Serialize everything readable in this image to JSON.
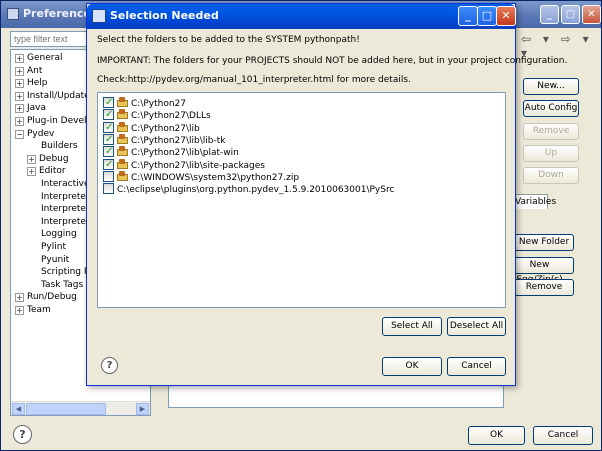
{
  "preferences": {
    "title": "Preferences",
    "filter_placeholder": "type filter text",
    "tree": [
      {
        "label": "General",
        "exp": "+",
        "indent": 0
      },
      {
        "label": "Ant",
        "exp": "+",
        "indent": 0
      },
      {
        "label": "Help",
        "exp": "+",
        "indent": 0
      },
      {
        "label": "Install/Update",
        "exp": "+",
        "indent": 0
      },
      {
        "label": "Java",
        "exp": "+",
        "indent": 0
      },
      {
        "label": "Plug-in Develop",
        "exp": "+",
        "indent": 0
      },
      {
        "label": "Pydev",
        "exp": "−",
        "indent": 0
      },
      {
        "label": "Builders",
        "exp": "",
        "indent": 1
      },
      {
        "label": "Debug",
        "exp": "+",
        "indent": 1
      },
      {
        "label": "Editor",
        "exp": "+",
        "indent": 1
      },
      {
        "label": "Interactive",
        "exp": "",
        "indent": 1
      },
      {
        "label": "Interprete",
        "exp": "",
        "indent": 1
      },
      {
        "label": "Interprete",
        "exp": "",
        "indent": 1
      },
      {
        "label": "Interprete",
        "exp": "",
        "indent": 1
      },
      {
        "label": "Logging",
        "exp": "",
        "indent": 1
      },
      {
        "label": "Pylint",
        "exp": "",
        "indent": 1
      },
      {
        "label": "Pyunit",
        "exp": "",
        "indent": 1
      },
      {
        "label": "Scripting Py",
        "exp": "",
        "indent": 1
      },
      {
        "label": "Task Tags",
        "exp": "",
        "indent": 1
      },
      {
        "label": "Run/Debug",
        "exp": "+",
        "indent": 0
      },
      {
        "label": "Team",
        "exp": "+",
        "indent": 0
      }
    ],
    "nav": {
      "back": "⇦",
      "back_menu": "▾",
      "forward": "⇨",
      "forward_menu": "▾",
      "view_menu": "▾"
    },
    "buttons": {
      "new": "New...",
      "auto_config": "Auto Config",
      "remove": "Remove",
      "up": "Up",
      "down": "Down",
      "new_folder": "New Folder",
      "new_egg": "New Egg/Zip(s)",
      "remove2": "Remove",
      "ok": "OK",
      "cancel": "Cancel"
    },
    "variables_tab": "Variables",
    "help": "?"
  },
  "dialog": {
    "title": "Selection Needed",
    "instruction": "Select the folders to be added to the SYSTEM pythonpath!",
    "important": "IMPORTANT: The folders for your PROJECTS should NOT be added here, but in your project configuration.",
    "check": "Check:http://pydev.org/manual_101_interpreter.html for more details.",
    "folders": [
      {
        "path": "C:\\Python27",
        "checked": true,
        "folder_icon": true
      },
      {
        "path": "C:\\Python27\\DLLs",
        "checked": true,
        "folder_icon": true
      },
      {
        "path": "C:\\Python27\\lib",
        "checked": true,
        "folder_icon": true
      },
      {
        "path": "C:\\Python27\\lib\\lib-tk",
        "checked": true,
        "folder_icon": true
      },
      {
        "path": "C:\\Python27\\lib\\plat-win",
        "checked": true,
        "folder_icon": true
      },
      {
        "path": "C:\\Python27\\lib\\site-packages",
        "checked": true,
        "folder_icon": true
      },
      {
        "path": "C:\\WINDOWS\\system32\\python27.zip",
        "checked": false,
        "folder_icon": true
      },
      {
        "path": "C:\\eclipse\\plugins\\org.python.pydev_1.5.9.2010063001\\PySrc",
        "checked": false,
        "folder_icon": false
      }
    ],
    "select_all": "Select All",
    "deselect_all": "Deselect All",
    "ok": "OK",
    "cancel": "Cancel",
    "help": "?"
  }
}
